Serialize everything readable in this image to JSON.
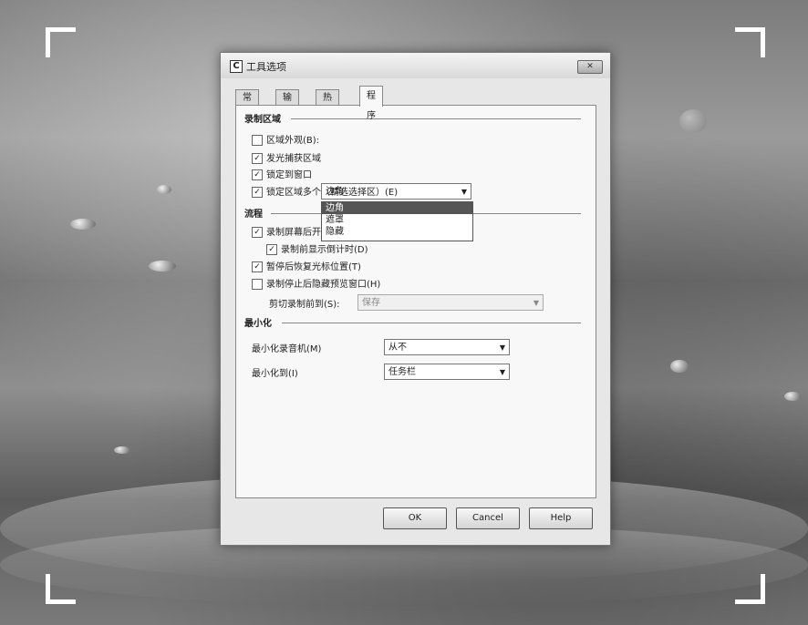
{
  "dialog": {
    "icon_letter": "C",
    "title": "工具选项",
    "close_symbol": "✕",
    "tabs": [
      {
        "label": "常规"
      },
      {
        "label": "输入"
      },
      {
        "label": "热键"
      },
      {
        "label": "程序"
      }
    ],
    "active_tab": "程序",
    "capture_section": {
      "heading": "录制区域",
      "outside_label": "区域外观(B):",
      "outside_value": "边角",
      "outside_options": [
        "边角",
        "遮罩",
        "隐藏"
      ],
      "opt1_label": "发光捕获区域",
      "opt2_label": "锁定到窗口",
      "opt3_label": "锁定区域多个（精选选择区）(E)"
    },
    "flow_section": {
      "heading": "流程",
      "opt1_label": "录制屏幕后开始捕获(B)",
      "opt2_label": "录制前显示倒计时(D)",
      "opt3_label": "暂停后恢复光标位置(T)",
      "opt4_label": "录制停止后隐藏预览窗口(H)",
      "save_label": "剪切录制前到(S):",
      "save_value": "保存"
    },
    "minimize_section": {
      "heading": "最小化",
      "recorder_label": "最小化录音机(M)",
      "recorder_value": "从不",
      "to_label": "最小化到(I)",
      "to_value": "任务栏"
    },
    "buttons": {
      "ok": "OK",
      "cancel": "Cancel",
      "help": "Help"
    }
  }
}
